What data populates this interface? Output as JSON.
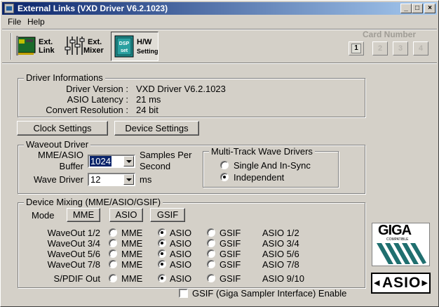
{
  "window": {
    "title": "External Links (VXD Driver V6.2.1023)"
  },
  "menu": {
    "file": "File",
    "help": "Help"
  },
  "toolbar": {
    "ext_link_l1": "Ext.",
    "ext_link_l2": "Link",
    "ext_mixer_l1": "Ext.",
    "ext_mixer_l2": "Mixer",
    "hw_l1": "H/W",
    "hw_l2": "Setting",
    "dsp_label": "DSP24 set",
    "card_number": "Card Number",
    "cards": [
      "1",
      "2",
      "3",
      "4"
    ]
  },
  "driver_info": {
    "title": "Driver Informations",
    "version_label": "Driver Version :",
    "version_value": "VXD Driver V6.2.1023",
    "latency_label": "ASIO Latency :",
    "latency_value": "21 ms",
    "resolution_label": "Convert Resolution :",
    "resolution_value": "24 bit"
  },
  "buttons": {
    "clock": "Clock Settings",
    "device": "Device Settings"
  },
  "waveout": {
    "title": "Waveout Driver",
    "buffer_label_1": "MME/ASIO",
    "buffer_label_2": "Buffer",
    "buffer_value": "1024",
    "samples_label_1": "Samples Per",
    "samples_label_2": "Second",
    "wave_driver_label": "Wave Driver",
    "wave_driver_value": "12",
    "ms_label": "ms",
    "multitrack": {
      "title": "Multi-Track Wave Drivers",
      "option1": "Single And In-Sync",
      "option2": "Independent",
      "selected": "Independent"
    }
  },
  "mixing": {
    "title": "Device Mixing (MME/ASIO/GSIF)",
    "mode_label": "Mode",
    "mode_buttons": [
      "MME",
      "ASIO",
      "GSIF"
    ],
    "col_mme": "MME",
    "col_asio": "ASIO",
    "col_gsif": "GSIF",
    "rows": [
      {
        "label": "WaveOut 1/2",
        "selected": "ASIO",
        "asio_name": "ASIO 1/2"
      },
      {
        "label": "WaveOut 3/4",
        "selected": "ASIO",
        "asio_name": "ASIO 3/4"
      },
      {
        "label": "WaveOut 5/6",
        "selected": "ASIO",
        "asio_name": "ASIO 5/6"
      },
      {
        "label": "WaveOut 7/8",
        "selected": "ASIO",
        "asio_name": "ASIO 7/8"
      },
      {
        "label": "S/PDIF Out",
        "selected": "ASIO",
        "asio_name": "ASIO 9/10"
      }
    ],
    "gsif_enable": "GSIF (Giga Sampler Interface) Enable",
    "gsif_checked": false
  },
  "logos": {
    "giga": "GIGA",
    "giga_sub": "COMPATIBLE",
    "asio": "ASIO"
  },
  "colors": {
    "title_start": "#0a246a",
    "title_end": "#a6caf0",
    "face": "#d4d0c8"
  }
}
